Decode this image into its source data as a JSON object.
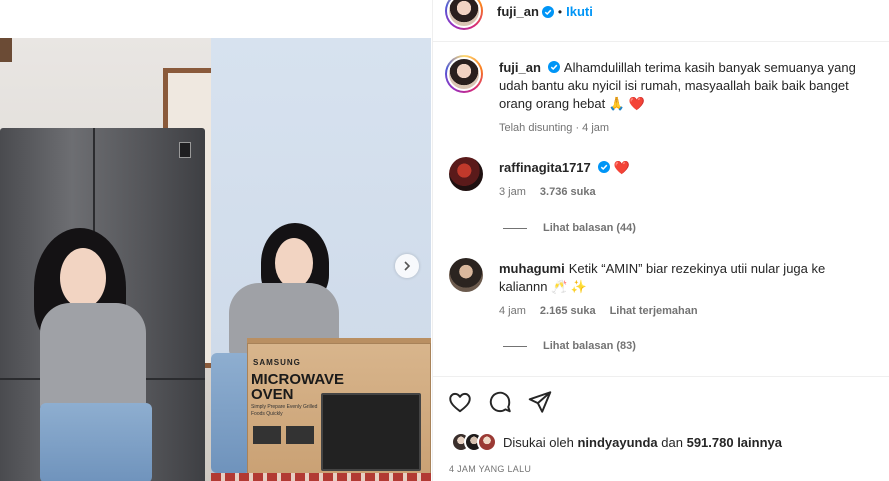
{
  "post": {
    "author": "fuji_an",
    "follow_label": "Ikuti",
    "dot": "•",
    "box_text": {
      "brand": "SAMSUNG",
      "title": "MICROWAVE OVEN",
      "subtitle": "Simply Prepare Evenly Grilled Foods Quickly"
    }
  },
  "caption": {
    "username": "fuji_an",
    "text": "Alhamdulillah terima kasih banyak semuanya yang udah bantu aku nyicil isi rumah, masyaallah baik baik banget orang orang hebat",
    "emoji": "🙏 ❤️",
    "meta": "Telah disunting · 4 jam"
  },
  "comments": [
    {
      "username": "raffinagita1717",
      "verified": true,
      "text": "❤️",
      "time": "3 jam",
      "likes": "3.736 suka",
      "replies": "Lihat balasan (44)"
    },
    {
      "username": "muhagumi",
      "verified": false,
      "text": "Ketik “AMIN” biar rezekinya utii nular juga ke kaliannn 🥂 ✨",
      "time": "4 jam",
      "likes": "2.165 suka",
      "translate": "Lihat terjemahan",
      "replies": "Lihat balasan (83)"
    }
  ],
  "likes_summary": {
    "prefix": "Disukai oleh",
    "user": "nindyayunda",
    "middle": "dan",
    "count": "591.780 lainnya"
  },
  "timestamp": "4 JAM YANG LALU",
  "colors": {
    "link_blue": "#0095f6",
    "verified_blue": "#0095f6",
    "heart_red": "#ed4956",
    "meta_gray": "#737373"
  },
  "icons": [
    "heart-icon",
    "comment-icon",
    "share-icon",
    "verified-icon",
    "chevron-right-icon"
  ]
}
